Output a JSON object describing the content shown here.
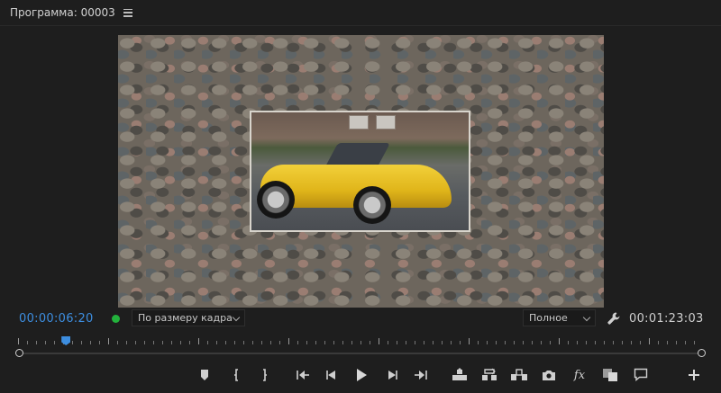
{
  "panel": {
    "title": "Программа: 00003"
  },
  "monitor": {
    "current_timecode": "00:00:06:20",
    "duration_timecode": "00:01:23:03",
    "zoom": {
      "selected": "По размеру кадра"
    },
    "quality": {
      "selected": "Полное"
    },
    "playhead_position_fraction": 0.07
  },
  "toolbar": {
    "buttons": [
      "marker-icon",
      "mark-in-icon",
      "mark-out-icon",
      "go-to-in-icon",
      "step-back-icon",
      "play-icon",
      "step-forward-icon",
      "go-to-out-icon",
      "lift-icon",
      "extract-icon",
      "export-frame-icon",
      "camera-icon",
      "fx-icon",
      "comparison-view-icon",
      "comment-icon",
      "add-button-icon"
    ],
    "fx_label": "fx"
  },
  "colors": {
    "accent": "#3d8ee0",
    "status_green": "#23b23c",
    "background": "#1e1e1e"
  }
}
